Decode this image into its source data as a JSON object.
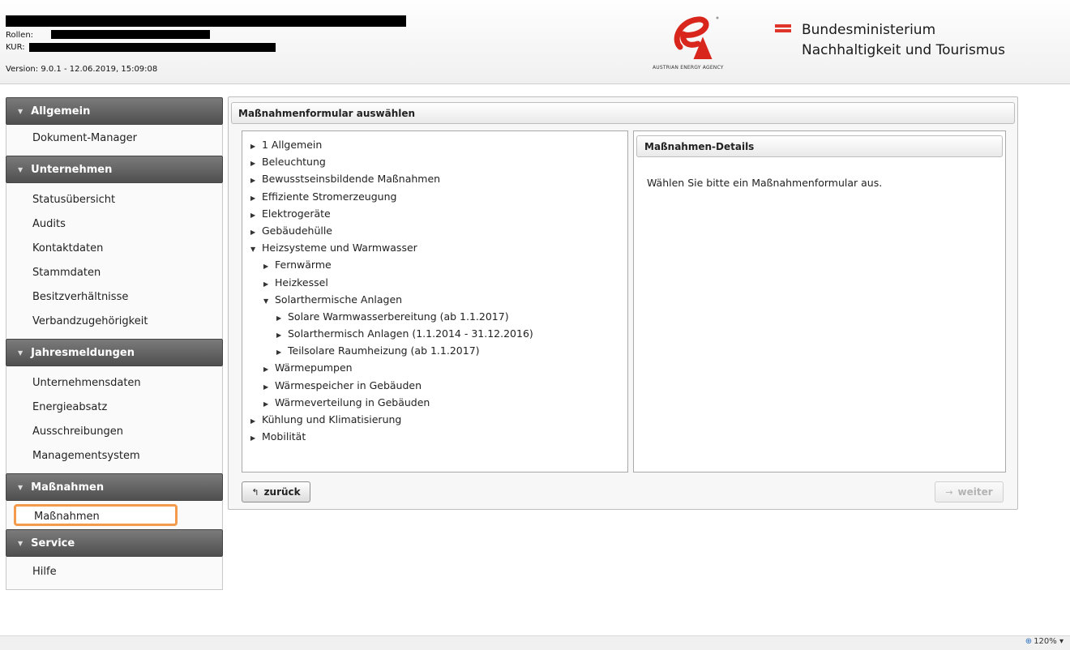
{
  "header": {
    "roles_label": "Rollen:",
    "kur_label": "KUR:",
    "version": "Version: 9.0.1 - 12.06.2019, 15:09:08",
    "agency_name": "AUSTRIAN ENERGY AGENCY",
    "ministry_line1": "Bundesministerium",
    "ministry_line2": "Nachhaltigkeit und Tourismus"
  },
  "sidebar": {
    "sections": [
      {
        "title": "Allgemein",
        "items": [
          "Dokument-Manager"
        ]
      },
      {
        "title": "Unternehmen",
        "items": [
          "Statusübersicht",
          "Audits",
          "Kontaktdaten",
          "Stammdaten",
          "Besitzverhältnisse",
          "Verbandzugehörigkeit"
        ]
      },
      {
        "title": "Jahresmeldungen",
        "items": [
          "Unternehmensdaten",
          "Energieabsatz",
          "Ausschreibungen",
          "Managementsystem"
        ]
      },
      {
        "title": "Maßnahmen",
        "items": [
          "Maßnahmen"
        ]
      },
      {
        "title": "Service",
        "items": [
          "Hilfe"
        ]
      }
    ],
    "active_item": "Maßnahmen"
  },
  "main": {
    "title": "Maßnahmenformular auswählen",
    "tree": [
      {
        "label": "1 Allgemein",
        "level": 0,
        "expanded": false
      },
      {
        "label": "Beleuchtung",
        "level": 0,
        "expanded": false
      },
      {
        "label": "Bewusstseinsbildende Maßnahmen",
        "level": 0,
        "expanded": false
      },
      {
        "label": "Effiziente Stromerzeugung",
        "level": 0,
        "expanded": false
      },
      {
        "label": "Elektrogeräte",
        "level": 0,
        "expanded": false
      },
      {
        "label": "Gebäudehülle",
        "level": 0,
        "expanded": false
      },
      {
        "label": "Heizsysteme und Warmwasser",
        "level": 0,
        "expanded": true
      },
      {
        "label": "Fernwärme",
        "level": 1,
        "expanded": false
      },
      {
        "label": "Heizkessel",
        "level": 1,
        "expanded": false
      },
      {
        "label": "Solarthermische Anlagen",
        "level": 1,
        "expanded": true
      },
      {
        "label": "Solare Warmwasserbereitung (ab 1.1.2017)",
        "level": 2,
        "expanded": false
      },
      {
        "label": "Solarthermisch Anlagen (1.1.2014 - 31.12.2016)",
        "level": 2,
        "expanded": false
      },
      {
        "label": "Teilsolare Raumheizung (ab 1.1.2017)",
        "level": 2,
        "expanded": false
      },
      {
        "label": "Wärmepumpen",
        "level": 1,
        "expanded": false
      },
      {
        "label": "Wärmespeicher in Gebäuden",
        "level": 1,
        "expanded": false
      },
      {
        "label": "Wärmeverteilung in Gebäuden",
        "level": 1,
        "expanded": false
      },
      {
        "label": "Kühlung und Klimatisierung",
        "level": 0,
        "expanded": false
      },
      {
        "label": "Mobilität",
        "level": 0,
        "expanded": false
      }
    ],
    "details_title": "Maßnahmen-Details",
    "details_text": "Wählen Sie bitte ein Maßnahmenformular aus.",
    "back_label": "zurück",
    "next_label": "weiter"
  },
  "statusbar": {
    "zoom": "120%"
  },
  "colors": {
    "accent_highlight": "#f39a4c",
    "logo_red": "#d9261c",
    "sidebar_header": "#5e5e5e"
  }
}
